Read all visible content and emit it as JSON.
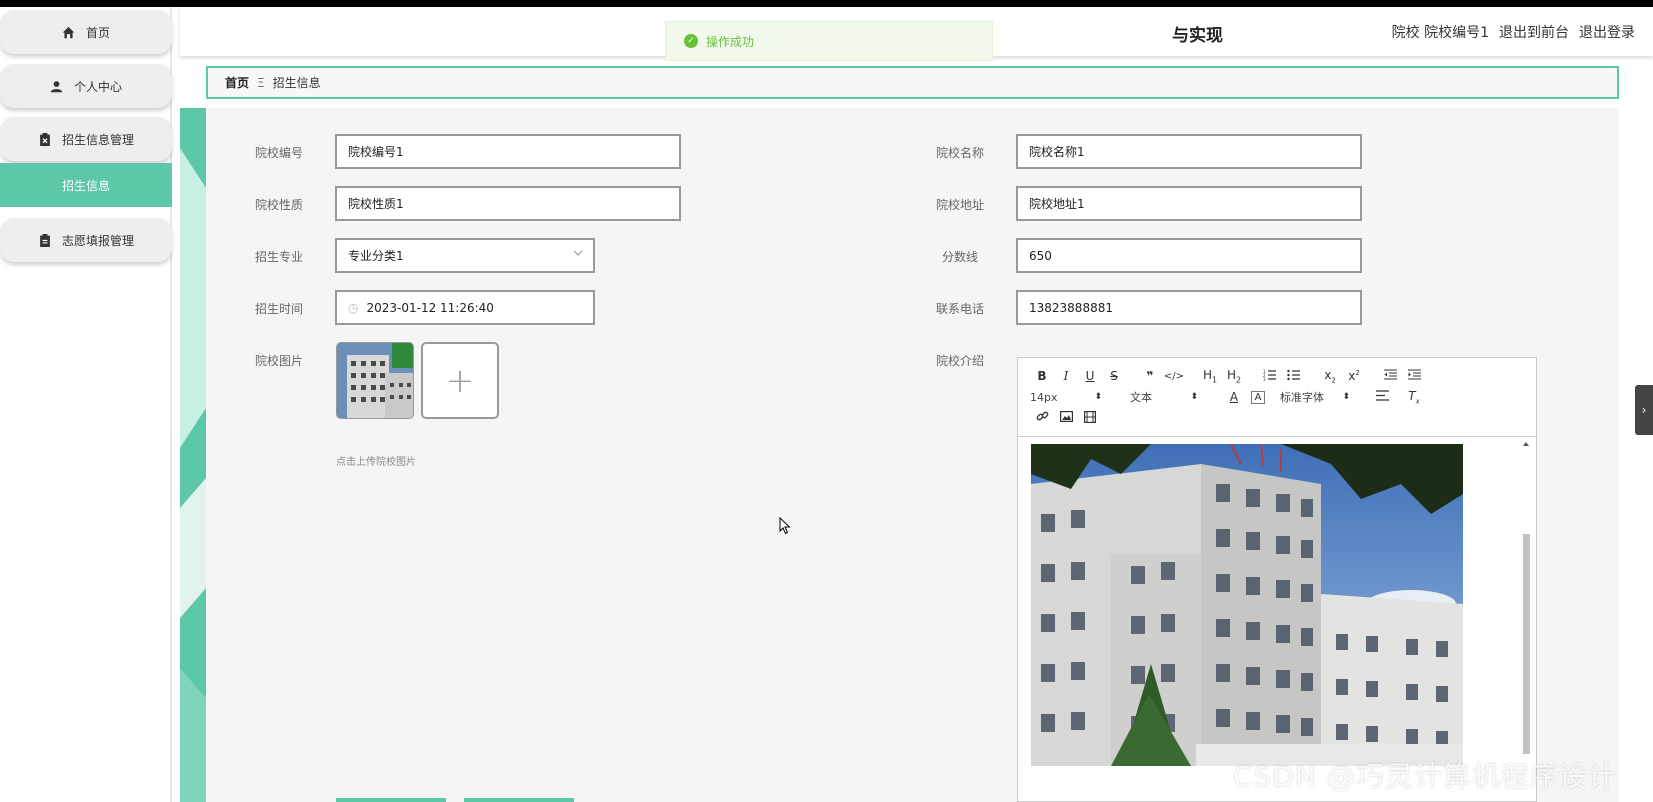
{
  "header": {
    "title": "与实现",
    "user_info": "院校 院校编号1",
    "back_to_front": "退出到前台",
    "logout": "退出登录"
  },
  "toast": {
    "message": "操作成功"
  },
  "sidebar": {
    "items": [
      {
        "label": "首页",
        "icon": "home-icon"
      },
      {
        "label": "个人中心",
        "icon": "user-icon"
      },
      {
        "label": "招生信息管理",
        "icon": "clipboard-x-icon"
      },
      {
        "label": "招生信息",
        "active": true
      },
      {
        "label": "志愿填报管理",
        "icon": "clipboard-icon"
      }
    ]
  },
  "breadcrumb": {
    "home": "首页",
    "separator": "Ξ",
    "current": "招生信息"
  },
  "form": {
    "school_code": {
      "label": "院校编号",
      "value": "院校编号1"
    },
    "school_name": {
      "label": "院校名称",
      "value": "院校名称1"
    },
    "school_type": {
      "label": "院校性质",
      "value": "院校性质1"
    },
    "school_address": {
      "label": "院校地址",
      "value": "院校地址1"
    },
    "major": {
      "label": "招生专业",
      "value": "专业分类1"
    },
    "score_line": {
      "label": "分数线",
      "value": "650"
    },
    "enroll_time": {
      "label": "招生时间",
      "value": "2023-01-12 11:26:40"
    },
    "phone": {
      "label": "联系电话",
      "value": "13823888881"
    },
    "school_image": {
      "label": "院校图片",
      "tip": "点击上传院校图片"
    },
    "intro": {
      "label": "院校介绍"
    }
  },
  "editor": {
    "font_size": "14px",
    "block_type": "文本",
    "font_family": "标准字体"
  },
  "watermark": "CSDN @巧灵计算机程序设计",
  "colors": {
    "accent": "#5dc7a9",
    "success": "#67c23a"
  }
}
